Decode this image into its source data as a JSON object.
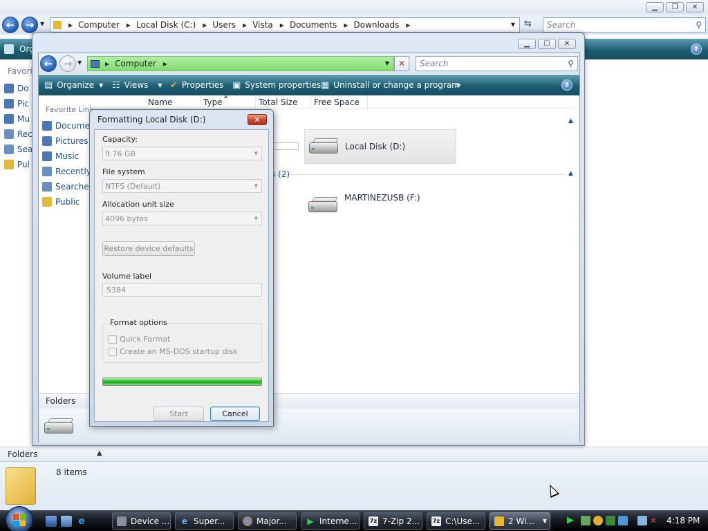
{
  "back_window": {
    "breadcrumb": [
      "Computer",
      "Local Disk (C:)",
      "Users",
      "Vista",
      "Documents",
      "Downloads"
    ],
    "search_placeholder": "Search",
    "organize_partial": "Org",
    "favorites_partial": "Favorit",
    "sidebar_items": [
      {
        "label": "Do",
        "icon": "documents-icon",
        "color": "#4a78b4"
      },
      {
        "label": "Pic",
        "icon": "pictures-icon",
        "color": "#4a78b4"
      },
      {
        "label": "Mu",
        "icon": "music-icon",
        "color": "#4a78b4"
      },
      {
        "label": "Rec",
        "icon": "recent-icon",
        "color": "#6a8fc4"
      },
      {
        "label": "Sea",
        "icon": "searches-icon",
        "color": "#6a8fc4"
      },
      {
        "label": "Pul",
        "icon": "folder-icon",
        "color": "#e6b83a"
      }
    ],
    "folders_label": "Folders",
    "items_count": "8 items"
  },
  "front_window": {
    "breadcrumb": [
      "Computer"
    ],
    "search_placeholder": "Search",
    "toolbar": {
      "organize": "Organize",
      "views": "Views",
      "properties": "Properties",
      "system_properties": "System properties",
      "uninstall": "Uninstall or change a program",
      "more": "»"
    },
    "favorite_links_label": "Favorite Links",
    "favorite_links": [
      {
        "label": "Documents",
        "icon": "documents-icon",
        "color": "#4a78b4"
      },
      {
        "label": "Pictures",
        "icon": "pictures-icon",
        "color": "#4a78b4"
      },
      {
        "label": "Music",
        "icon": "music-icon",
        "color": "#4a78b4"
      },
      {
        "label": "Recently Changed",
        "icon": "recent-icon",
        "color": "#6a8fc4"
      },
      {
        "label": "Searches",
        "icon": "searches-icon",
        "color": "#6a8fc4"
      },
      {
        "label": "Public",
        "icon": "folder-icon",
        "color": "#e6b83a"
      }
    ],
    "columns": [
      "Name",
      "Type",
      "Total Size",
      "Free Space"
    ],
    "group_removable_count": "s (2)",
    "drives": [
      {
        "label": "Local Disk (D:)",
        "selected": true
      },
      {
        "label": "MARTINEZUSB (F:)",
        "selected": false
      }
    ],
    "folders_label": "Folders"
  },
  "dialog": {
    "title": "Formatting Local Disk (D:)",
    "close_glyph": "✕",
    "capacity_label": "Capacity:",
    "capacity_value": "9.76 GB",
    "filesystem_label": "File system",
    "filesystem_value": "NTFS (Default)",
    "allocation_label": "Allocation unit size",
    "allocation_value": "4096 bytes",
    "restore_label": "Restore device defaults",
    "volume_label_label": "Volume label",
    "volume_label_value": "5384",
    "format_options_label": "Format options",
    "quick_format_label": "Quick Format",
    "msdos_label": "Create an MS-DOS startup disk",
    "progress_percent": 100,
    "start_label": "Start",
    "cancel_label": "Cancel"
  },
  "taskbar": {
    "buttons": [
      {
        "label": "Device ...",
        "icon": "device-manager-icon",
        "color": "#8a8f98"
      },
      {
        "label": "Super...",
        "icon": "ie-icon",
        "color": "#2d7fd8"
      },
      {
        "label": "Major...",
        "icon": "firefox-icon",
        "color": "#d86a1e"
      },
      {
        "label": "Interne...",
        "icon": "internet-icon",
        "color": "#2fa84a"
      },
      {
        "label": "7-Zip 2...",
        "icon": "7zip-icon",
        "color": "#222222"
      },
      {
        "label": "C:\\Use...",
        "icon": "7zip-icon",
        "color": "#222222"
      },
      {
        "label": "2 Wi...",
        "icon": "explorer-folder-icon",
        "color": "#e6b83a"
      }
    ],
    "clock": "4:18 PM"
  }
}
